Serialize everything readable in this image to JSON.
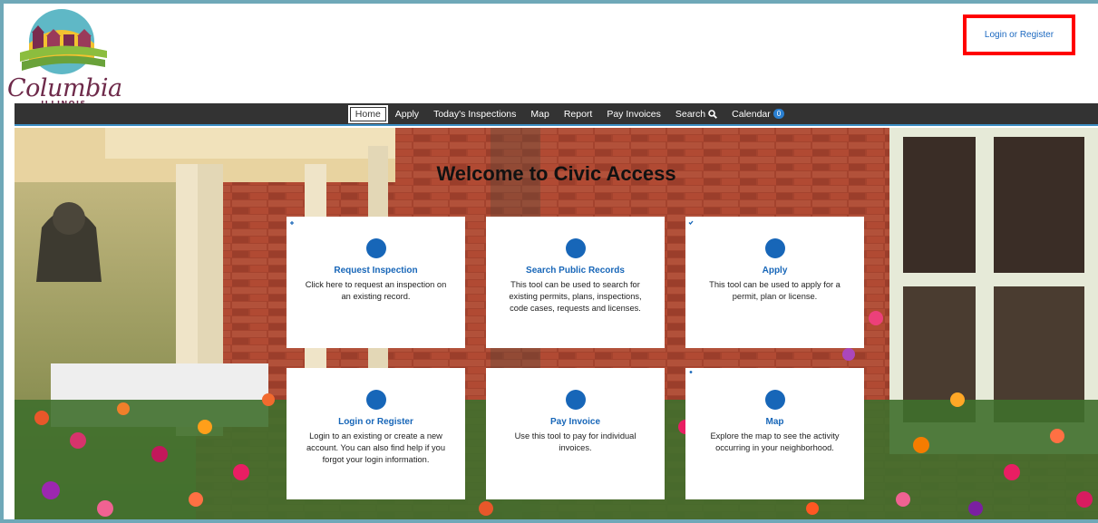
{
  "logo": {
    "name": "Columbia",
    "sub": "ILLINOIS"
  },
  "header": {
    "login_label": "Login or Register"
  },
  "nav": {
    "items": [
      {
        "label": "Home"
      },
      {
        "label": "Apply"
      },
      {
        "label": "Today's Inspections"
      },
      {
        "label": "Map"
      },
      {
        "label": "Report"
      },
      {
        "label": "Pay Invoices"
      },
      {
        "label": "Search"
      },
      {
        "label": "Calendar",
        "badge": "0"
      }
    ]
  },
  "hero": {
    "title": "Welcome to Civic Access"
  },
  "cards": [
    {
      "title": "Request Inspection",
      "desc": "Click here to request an inspection on an existing record.",
      "icon": "calendar-plus-icon"
    },
    {
      "title": "Search Public Records",
      "desc": "This tool can be used to search for existing permits, plans, inspections, code cases, requests and licenses.",
      "icon": "search-icon"
    },
    {
      "title": "Apply",
      "desc": "This tool can be used to apply for a permit, plan or license.",
      "icon": "clipboard-check-icon"
    },
    {
      "title": "Login or Register",
      "desc": "Login to an existing or create a new account. You can also find help if you forgot your login information.",
      "icon": "users-icon"
    },
    {
      "title": "Pay Invoice",
      "desc": "Use this tool to pay for individual invoices.",
      "icon": "dollar-icon"
    },
    {
      "title": "Map",
      "desc": "Explore the map to see the activity occurring in your neighborhood.",
      "icon": "map-pin-icon"
    }
  ],
  "colors": {
    "accent": "#1766b8",
    "nav_bg": "#333333",
    "highlight": "#ff0000",
    "logo": "#6e2a4a"
  }
}
